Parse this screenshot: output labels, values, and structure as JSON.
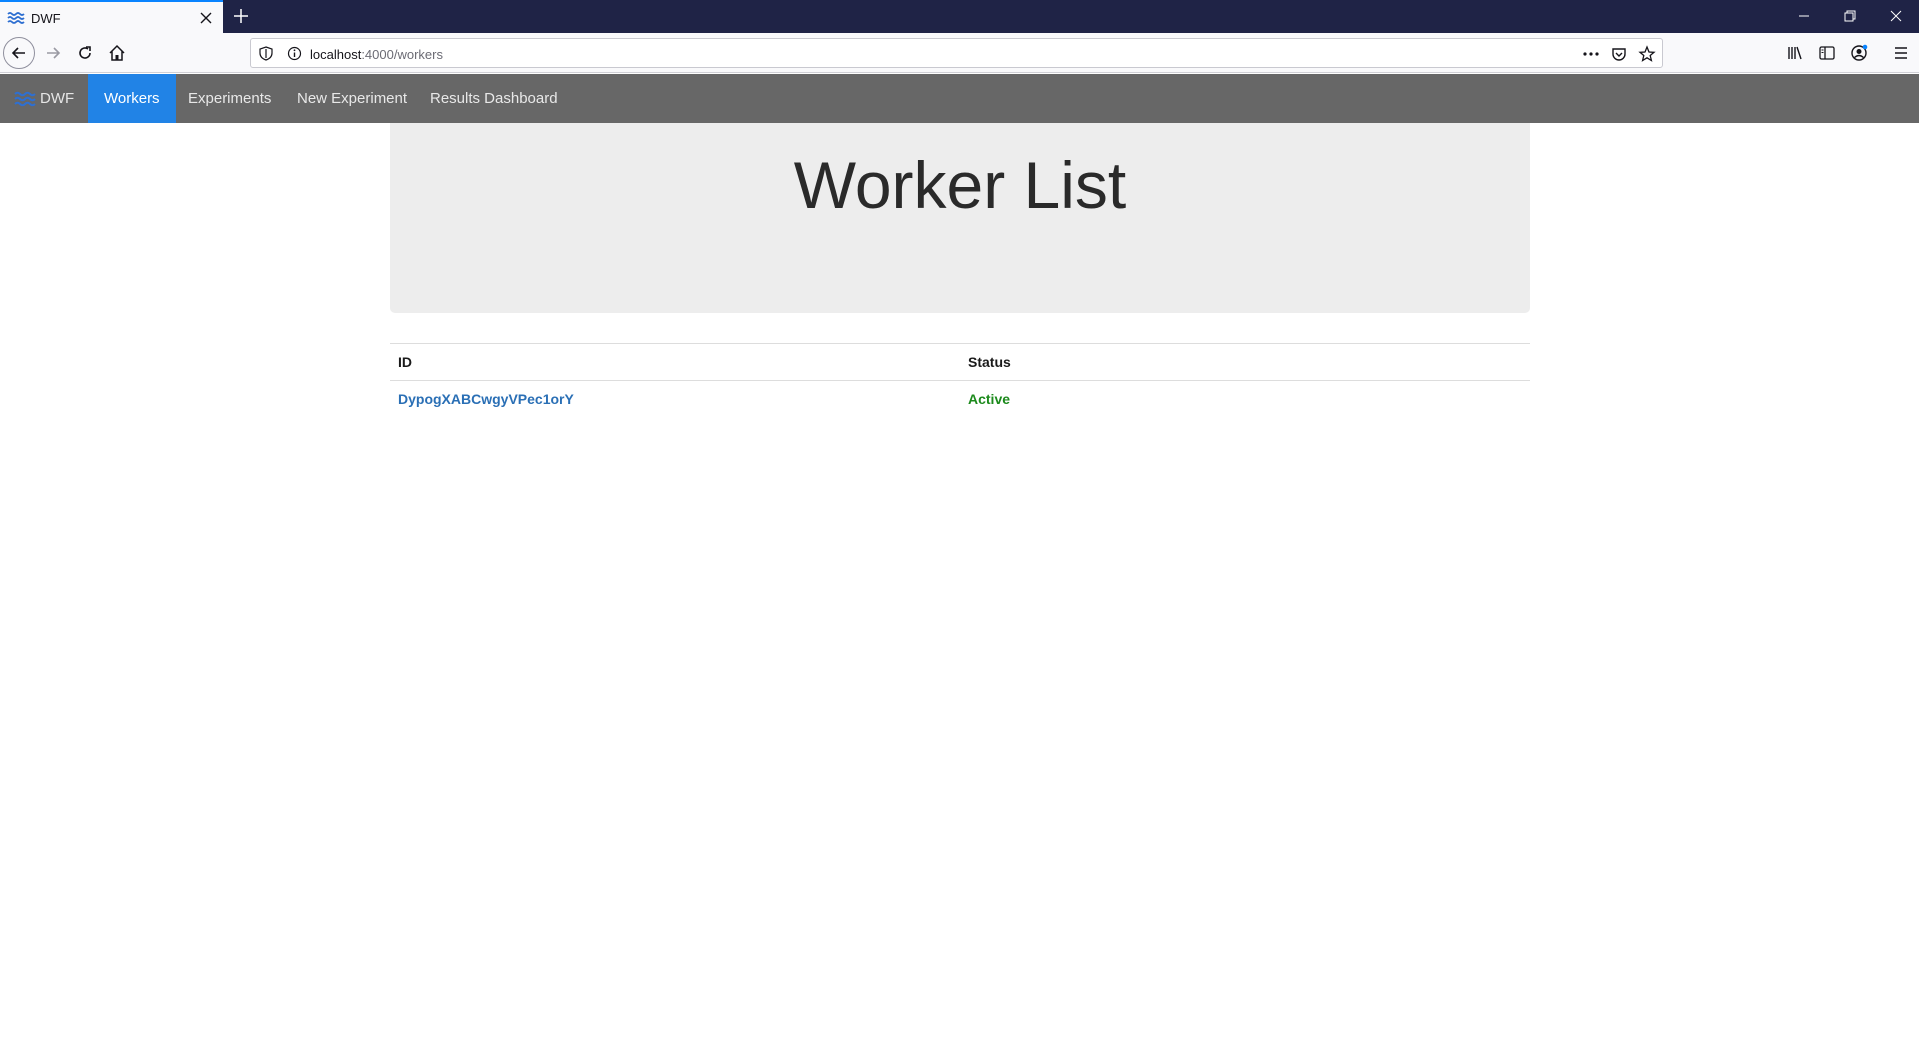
{
  "browser": {
    "tab_title": "DWF",
    "url_host": "localhost",
    "url_path": ":4000/workers"
  },
  "app_nav": {
    "brand": "DWF",
    "links": [
      {
        "label": "Workers",
        "active": true
      },
      {
        "label": "Experiments",
        "active": false
      },
      {
        "label": "New Experiment",
        "active": false
      },
      {
        "label": "Results Dashboard",
        "active": false
      }
    ]
  },
  "page": {
    "title": "Worker List"
  },
  "table": {
    "headers": [
      "ID",
      "Status"
    ],
    "rows": [
      {
        "id": "DypogXABCwgyVPec1orY",
        "status": "Active"
      }
    ]
  },
  "colors": {
    "nav_bg": "#676767",
    "nav_active": "#2183e6",
    "link": "#2a6fb5",
    "status_active": "#1c8a1c",
    "jumbotron_bg": "#ededed"
  }
}
